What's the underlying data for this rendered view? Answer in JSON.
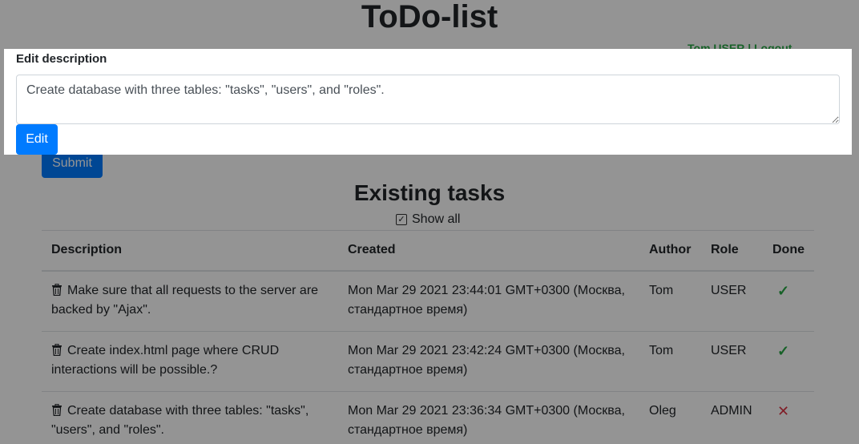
{
  "app": {
    "title": "ToDo-list"
  },
  "userbar": {
    "text": "Tom  USER | Logout"
  },
  "form": {
    "submit_label": "Submit"
  },
  "tasks": {
    "heading": "Existing tasks",
    "show_all_label": "Show all",
    "show_all_checked": true,
    "columns": [
      "Description",
      "Created",
      "Author",
      "Role",
      "Done"
    ],
    "rows": [
      {
        "description": "Make sure that all requests to the server are backed by \"Ajax\".",
        "created": "Mon Mar 29 2021 23:44:01 GMT+0300 (Москва, стандартное время)",
        "author": "Tom",
        "role": "USER",
        "done": true
      },
      {
        "description": "Create index.html page where CRUD interactions will be possible.?",
        "created": "Mon Mar 29 2021 23:42:24 GMT+0300 (Москва, стандартное время)",
        "author": "Tom",
        "role": "USER",
        "done": true
      },
      {
        "description": "Create database with three tables: \"tasks\", \"users\", and \"roles\".",
        "created": "Mon Mar 29 2021 23:36:34 GMT+0300 (Москва, стандартное время)",
        "author": "Oleg",
        "role": "ADMIN",
        "done": false
      }
    ]
  },
  "modal": {
    "label": "Edit description",
    "value": "Create database with three tables: \"tasks\", \"users\", and \"roles\".",
    "button_label": "Edit"
  },
  "icons": {
    "trash": "trash-icon",
    "done_true": "check-icon",
    "done_false": "cross-icon"
  },
  "colors": {
    "primary": "#007bff",
    "success": "#28a745",
    "danger": "#dc3545"
  }
}
